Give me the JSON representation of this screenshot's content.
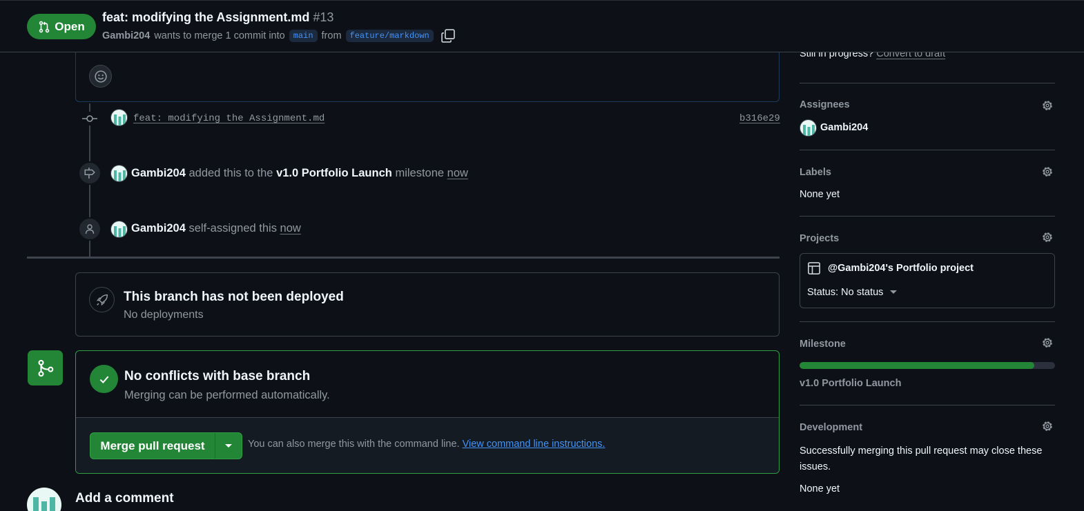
{
  "header": {
    "status_label": "Open",
    "title": "feat: modifying the Assignment.md",
    "number": "#13",
    "author": "Gambi204",
    "merge_text": "wants to merge 1 commit into",
    "base_branch": "main",
    "from_text": "from",
    "head_branch": "feature/markdown"
  },
  "timeline": {
    "commit": {
      "message": "feat: modifying the Assignment.md",
      "sha": "b316e29"
    },
    "milestone_event": {
      "actor": "Gambi204",
      "pre": "added this to the",
      "milestone": "v1.0 Portfolio Launch",
      "post": "milestone",
      "time": "now"
    },
    "assign_event": {
      "actor": "Gambi204",
      "text": "self-assigned this",
      "time": "now"
    }
  },
  "deploy": {
    "title": "This branch has not been deployed",
    "subtitle": "No deployments"
  },
  "merge": {
    "title": "No conflicts with base branch",
    "subtitle": "Merging can be performed automatically.",
    "button_label": "Merge pull request",
    "hint": "You can also merge this with the command line.",
    "hint_link": "View command line instructions."
  },
  "add_comment": {
    "title": "Add a comment"
  },
  "sidebar": {
    "draft_prefix": "Still in progress?",
    "draft_link": "Convert to draft",
    "assignees": {
      "heading": "Assignees",
      "name": "Gambi204"
    },
    "labels": {
      "heading": "Labels",
      "value": "None yet"
    },
    "projects": {
      "heading": "Projects",
      "name": "@Gambi204's Portfolio project",
      "status": "Status: No status"
    },
    "milestone": {
      "heading": "Milestone",
      "name": "v1.0 Portfolio Launch",
      "progress": 0.92
    },
    "development": {
      "heading": "Development",
      "text": "Successfully merging this pull request may close these issues.",
      "value": "None yet"
    }
  },
  "colors": {
    "accent_green": "#238636",
    "link_blue": "#4493f8",
    "bg": "#0d1117"
  }
}
